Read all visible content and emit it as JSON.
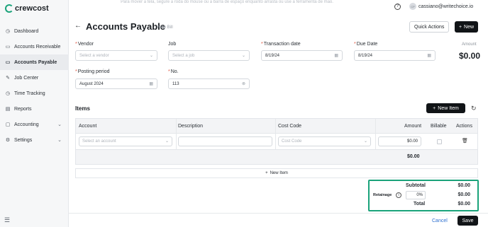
{
  "app": {
    "logo_text": "crewcost"
  },
  "header": {
    "hint": "Para mover a tela, segure a roda do mouse ou a barra de espaço enquanto arrasta ou use a ferramenta de mão.",
    "user_initials": "CP",
    "user_email": "cassiano@writechoice.io"
  },
  "sidebar": {
    "items": [
      {
        "label": "Dashboard",
        "icon": "dashboard-icon",
        "glyph": "◷"
      },
      {
        "label": "Accounts Receivable",
        "icon": "receivable-icon",
        "glyph": "▭"
      },
      {
        "label": "Accounts Payable",
        "icon": "payable-icon",
        "glyph": "▭"
      },
      {
        "label": "Job Center",
        "icon": "wrench-icon",
        "glyph": "✎"
      },
      {
        "label": "Time Tracking",
        "icon": "clock-icon",
        "glyph": "◷"
      },
      {
        "label": "Reports",
        "icon": "report-icon",
        "glyph": "▤"
      },
      {
        "label": "Accounting",
        "icon": "accounting-icon",
        "glyph": "▢"
      },
      {
        "label": "Settings",
        "icon": "gear-icon",
        "glyph": "⚙"
      }
    ]
  },
  "page": {
    "title": "Accounts Payable",
    "subtitle": "New Bill",
    "quick_actions": "Quick Actions",
    "new_label": "New"
  },
  "form": {
    "vendor": {
      "label": "Vendor",
      "placeholder": "Select a vendor"
    },
    "job": {
      "label": "Job",
      "placeholder": "Select a job"
    },
    "transaction_date": {
      "label": "Transaction date",
      "value": "8/19/24"
    },
    "due_date": {
      "label": "Due Date",
      "value": "8/19/24"
    },
    "amount": {
      "label": "Amount",
      "value": "$0.00"
    },
    "posting_period": {
      "label": "Posting period",
      "value": "August 2024"
    },
    "number": {
      "label": "No.",
      "value": "113"
    }
  },
  "items": {
    "title": "Items",
    "new_item_button": "New Item",
    "columns": [
      "Account",
      "Description",
      "Cost Code",
      "Amount",
      "Billable",
      "Actions"
    ],
    "row": {
      "account_placeholder": "Select an account",
      "cost_code_placeholder": "Cost Code",
      "amount": "$0.00"
    },
    "row_total": "$0.00",
    "add_row_label": "New Item"
  },
  "totals": {
    "subtotal_label": "Subtotal",
    "subtotal_value": "$0.00",
    "retainage_label": "Retainage",
    "retainage_percent": "0%",
    "retainage_value": "$0.00",
    "total_label": "Total",
    "total_value": "$0.00"
  },
  "footer": {
    "cancel": "Cancel",
    "save": "Save"
  },
  "colors": {
    "accent": "#1aa37a",
    "primary_button": "#111417",
    "required": "#e0533d",
    "link": "#2d6fd0"
  }
}
